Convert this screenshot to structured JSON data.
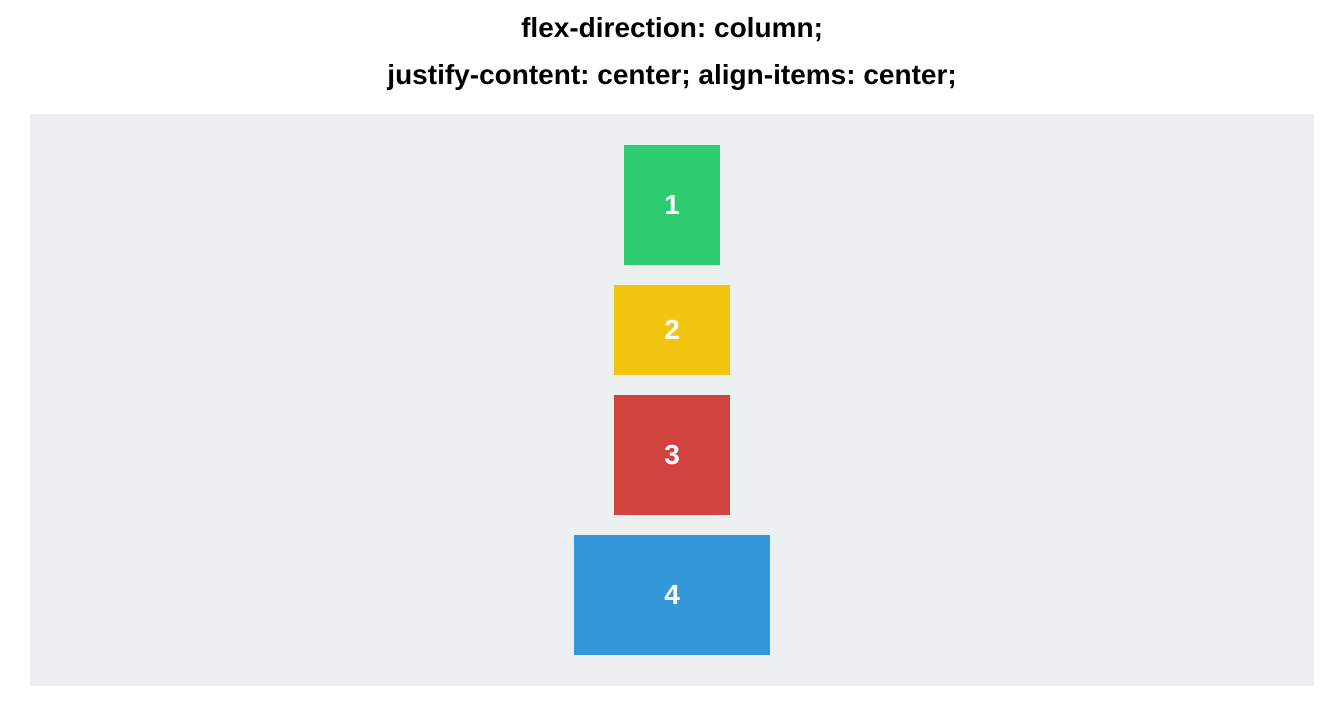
{
  "heading": {
    "line1": "flex-direction: column;",
    "line2": "justify-content: center; align-items: center;"
  },
  "boxes": {
    "b1": {
      "label": "1",
      "color": "#2ecc71"
    },
    "b2": {
      "label": "2",
      "color": "#f1c40f"
    },
    "b3": {
      "label": "3",
      "color": "#d0433f"
    },
    "b4": {
      "label": "4",
      "color": "#3498db"
    }
  },
  "container_bg": "#ecf0f1"
}
